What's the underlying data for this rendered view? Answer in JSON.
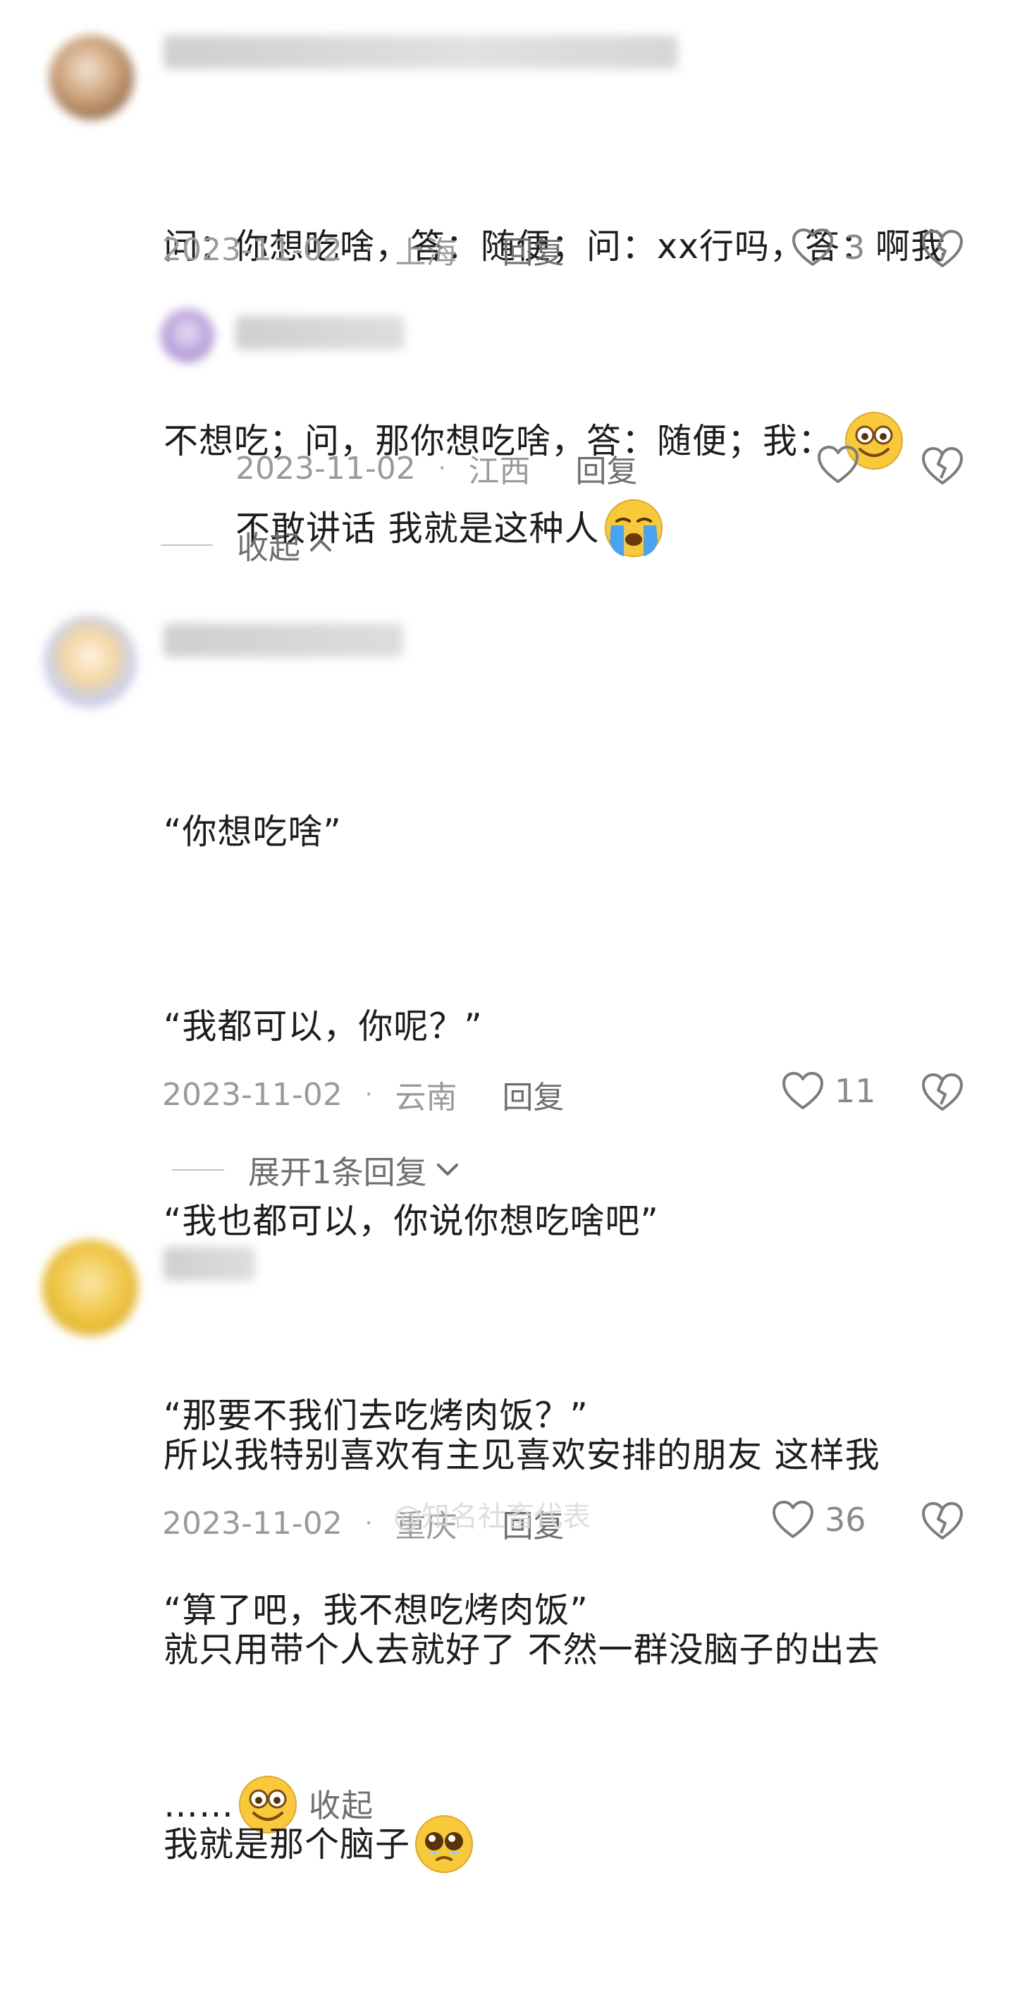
{
  "comments": [
    {
      "text_lines": [
        "问：你想吃啥，答：随便；问：xx行吗，答：啊我",
        "不想吃；问，那你想吃啥，答：随便；我："
      ],
      "date": "2023-11-02",
      "location": "上海",
      "reply_label": "回复",
      "like_count": "3",
      "emoji": "smiling-face-icon"
    },
    {
      "text_lines": [
        "不敢讲话 我就是这种人"
      ],
      "date": "2023-11-02",
      "location": "江西",
      "reply_label": "回复",
      "like_count": "",
      "emoji": "crying-face-icon"
    },
    {
      "text_lines": [
        "“你想吃啥”",
        "“我都可以，你呢？”",
        "“我也都可以，你说你想吃啥吧”",
        "“那要不我们去吃烤肉饭？”",
        "“算了吧，我不想吃烤肉饭”",
        "……"
      ],
      "collapse_inline": "收起",
      "date": "2023-11-02",
      "location": "云南",
      "reply_label": "回复",
      "like_count": "11",
      "emoji": "smiling-face-icon"
    },
    {
      "text_lines": [
        "所以我特别喜欢有主见喜欢安排的朋友 这样我",
        "就只用带个人去就好了 不然一群没脑子的出去",
        "我就是那个脑子"
      ],
      "date": "2023-11-02",
      "location": "重庆",
      "reply_label": "回复",
      "like_count": "36",
      "emoji": "pleading-face-icon"
    }
  ],
  "collapse_replies": "收起",
  "expand_replies": "展开1条回复",
  "watermark": "@知名社畜代表",
  "colors": {
    "meta": "#9a9a9a",
    "text": "#1d1d1d",
    "emoji": "#f8c93a"
  }
}
